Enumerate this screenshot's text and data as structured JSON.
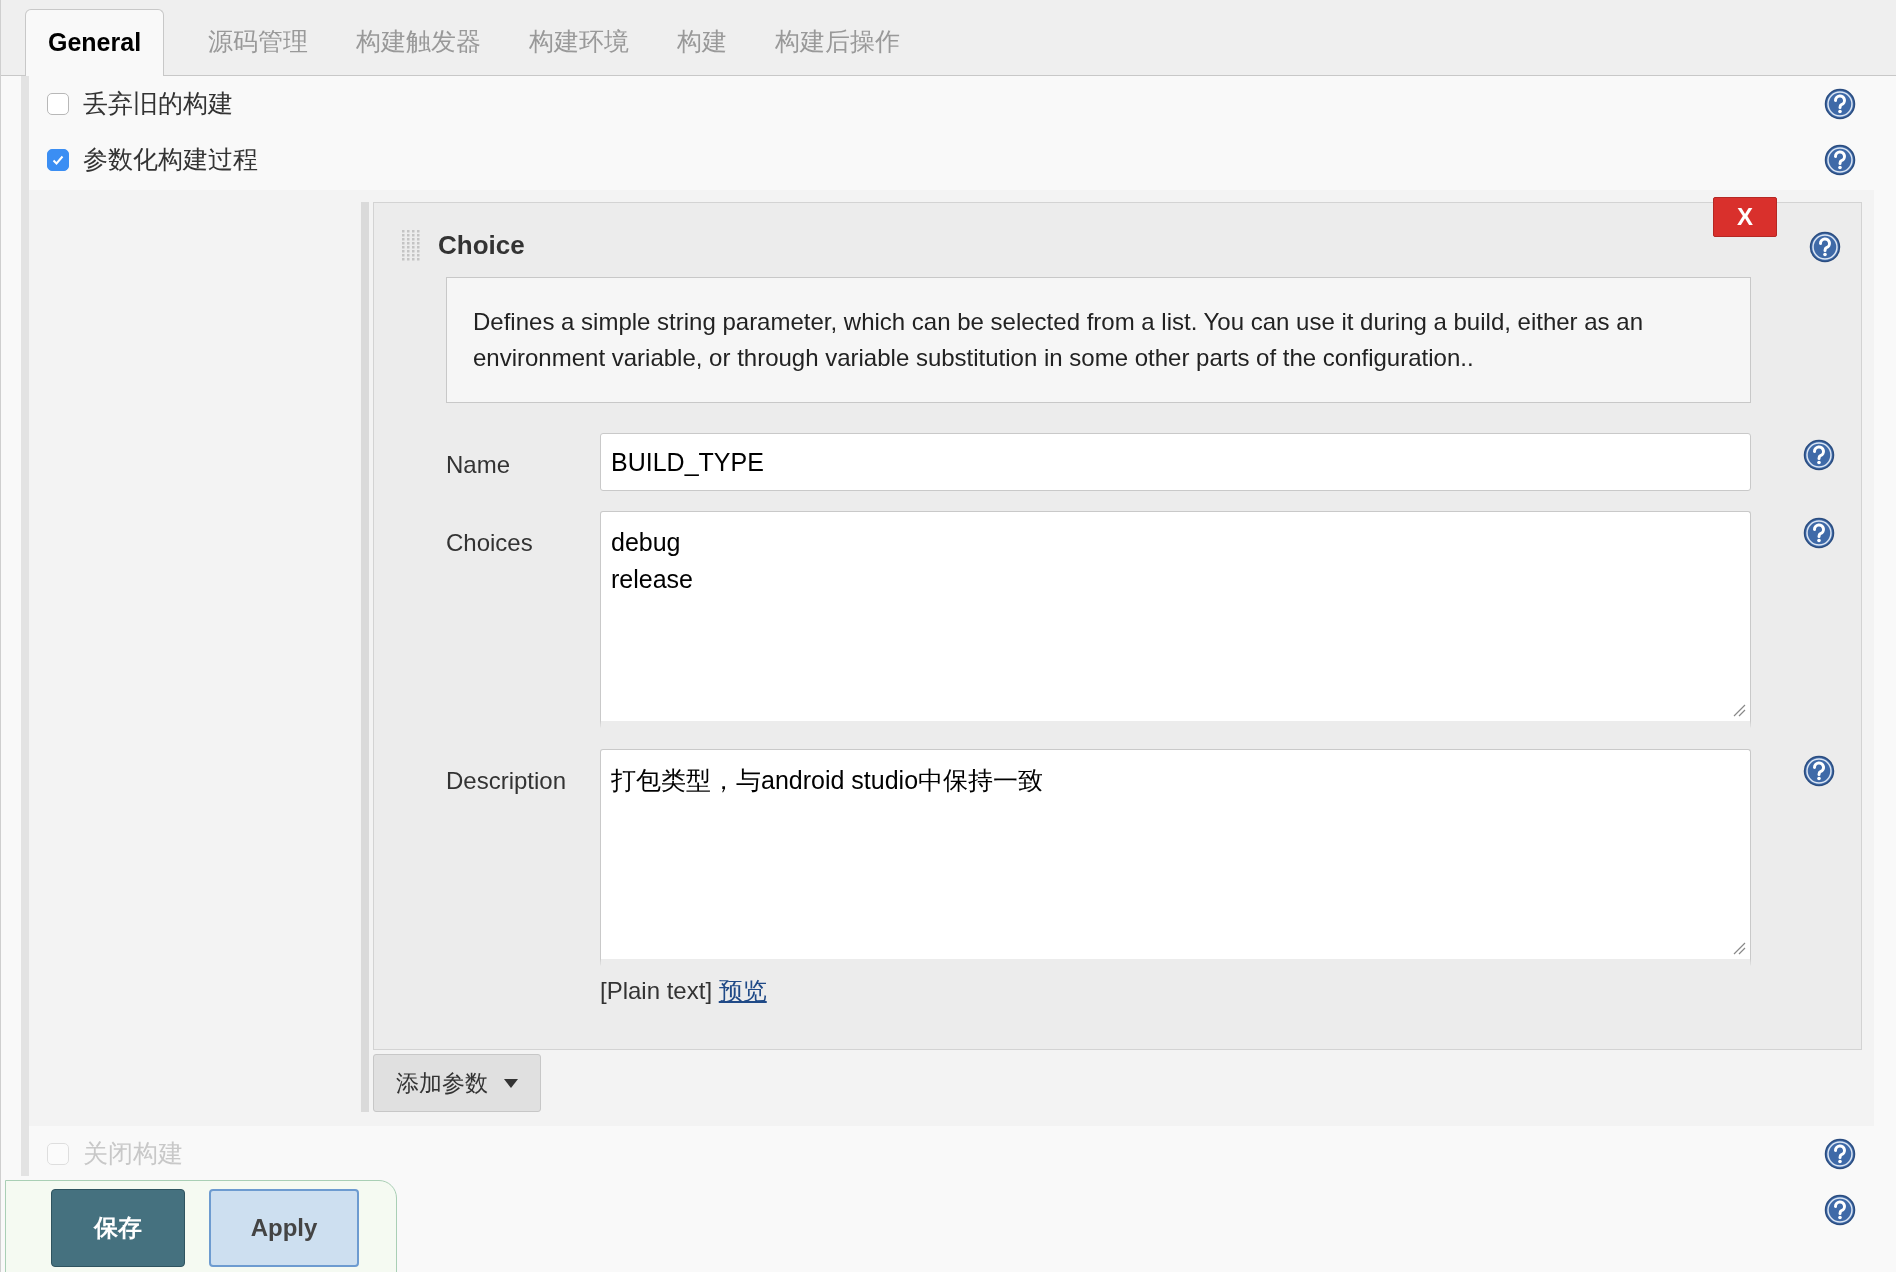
{
  "tabs": [
    {
      "label": "General",
      "selected": true
    },
    {
      "label": "源码管理",
      "selected": false
    },
    {
      "label": "构建触发器",
      "selected": false
    },
    {
      "label": "构建环境",
      "selected": false
    },
    {
      "label": "构建",
      "selected": false
    },
    {
      "label": "构建后操作",
      "selected": false
    }
  ],
  "options": [
    {
      "label": "丢弃旧的构建",
      "checked": false
    },
    {
      "label": "参数化构建过程",
      "checked": true
    }
  ],
  "parameter": {
    "title": "Choice",
    "delete_label": "X",
    "description": "Defines a simple string parameter, which can be selected from a list. You can use it during a build, either as an environment variable, or through variable substitution in some other parts of the configuration..",
    "fields": [
      {
        "kind": "input",
        "label": "Name",
        "value": "BUILD_TYPE"
      },
      {
        "kind": "textarea",
        "label": "Choices",
        "value": "debug\nrelease"
      },
      {
        "kind": "textarea",
        "label": "Description",
        "value": "打包类型，与android studio中保持一致"
      }
    ],
    "format_note": "[Plain text]",
    "preview_link": "预览"
  },
  "add_button": "添加参数",
  "lower_options": [
    {
      "label": "关闭构建",
      "checked": false
    }
  ],
  "save_bar": {
    "save": "保存",
    "apply": "Apply"
  }
}
